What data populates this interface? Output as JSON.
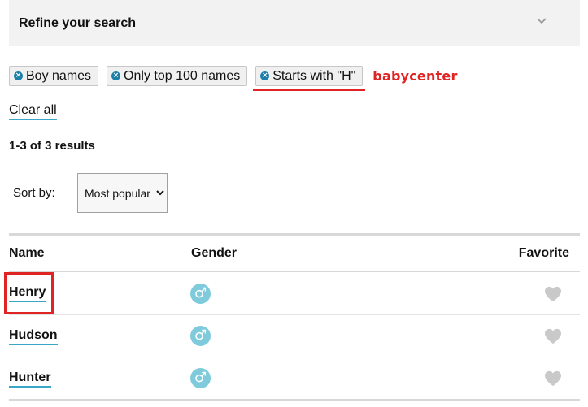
{
  "refine": {
    "title": "Refine your search"
  },
  "filters": [
    {
      "label": "Boy names"
    },
    {
      "label": "Only top 100 names"
    },
    {
      "label": "Starts with \"H\""
    }
  ],
  "annotation": {
    "brand": "babycenter",
    "highlight_color": "#e02424"
  },
  "clear_all": "Clear all",
  "results_count": "1-3 of 3 results",
  "sort": {
    "label": "Sort by:",
    "options": [
      "Most popular"
    ],
    "selected": "Most popular"
  },
  "table": {
    "headers": {
      "name": "Name",
      "gender": "Gender",
      "favorite": "Favorite"
    },
    "rows": [
      {
        "name": "Henry",
        "gender": "male",
        "gender_symbol": "♂"
      },
      {
        "name": "Hudson",
        "gender": "male",
        "gender_symbol": "♂"
      },
      {
        "name": "Hunter",
        "gender": "male",
        "gender_symbol": "♂"
      }
    ]
  },
  "colors": {
    "accent": "#3aa7c7",
    "chip_icon": "#1c7fa8",
    "male_icon": "#7fcbdc",
    "heart": "#c9c9c9"
  }
}
